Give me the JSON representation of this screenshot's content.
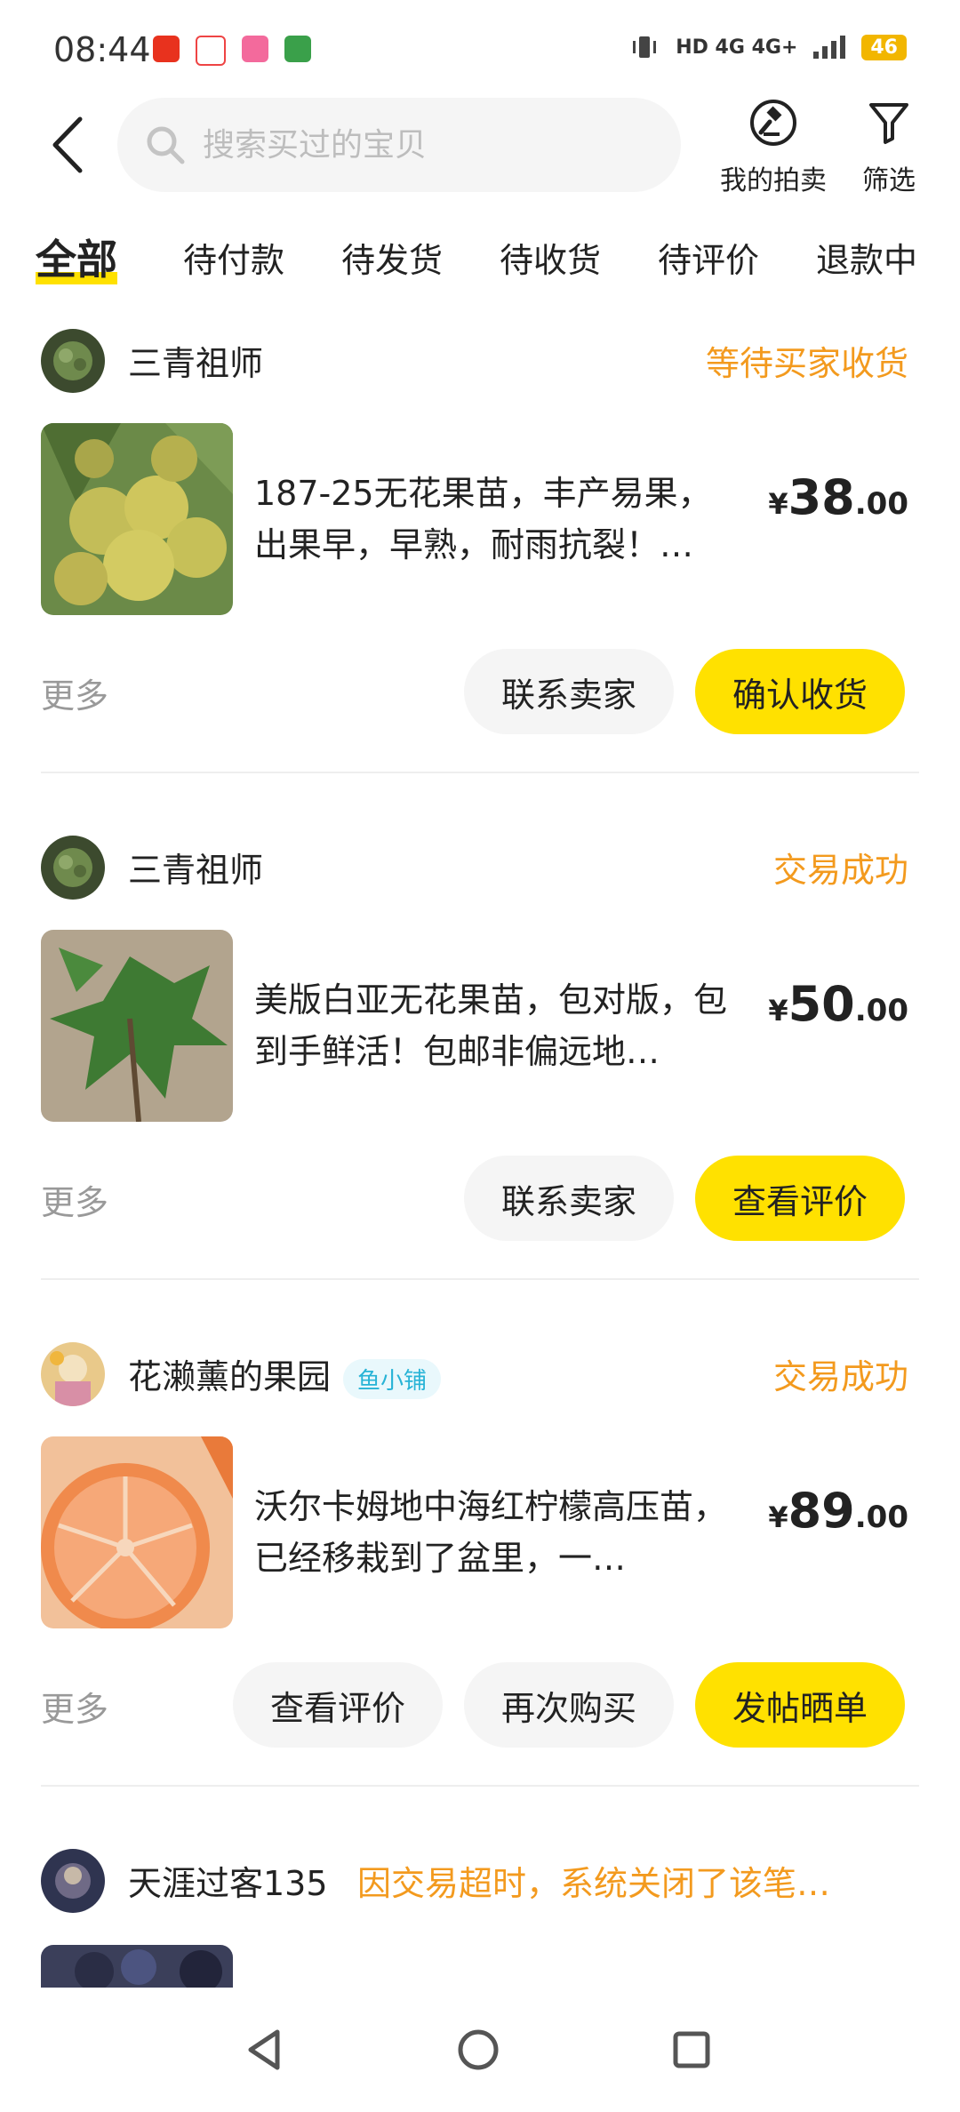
{
  "status_bar": {
    "time": "08:44",
    "network": "HD 4G 4G+",
    "battery": "46"
  },
  "search": {
    "placeholder": "搜索买过的宝贝"
  },
  "header": {
    "auction_label": "我的拍卖",
    "filter_label": "筛选"
  },
  "tabs": [
    {
      "label": "全部",
      "active": true
    },
    {
      "label": "待付款"
    },
    {
      "label": "待发货"
    },
    {
      "label": "待收货"
    },
    {
      "label": "待评价"
    },
    {
      "label": "退款中"
    }
  ],
  "orders": [
    {
      "shop": "三青祖师",
      "status": "等待买家收货",
      "title": "187-25无花果苗，丰产易果，出果早，早熟，耐雨抗裂！…",
      "price_currency": "¥",
      "price_int": "38",
      "price_dec": ".00",
      "more": "更多",
      "buttons": [
        "联系卖家",
        "确认收货"
      ]
    },
    {
      "shop": "三青祖师",
      "status": "交易成功",
      "title": "美版白亚无花果苗，包对版，包到手鲜活！包邮非偏远地…",
      "price_currency": "¥",
      "price_int": "50",
      "price_dec": ".00",
      "more": "更多",
      "buttons": [
        "联系卖家",
        "查看评价"
      ]
    },
    {
      "shop": "花濑薰的果园",
      "badge": "鱼小铺",
      "status": "交易成功",
      "title": "沃尔卡姆地中海红柠檬高压苗，已经移栽到了盆里，一…",
      "price_currency": "¥",
      "price_int": "89",
      "price_dec": ".00",
      "more": "更多",
      "buttons": [
        "查看评价",
        "再次购买",
        "发帖晒单"
      ]
    },
    {
      "shop": "天涯过客135",
      "status": "因交易超时，系统关闭了该笔…"
    }
  ],
  "colors": {
    "accent_yellow": "#ffe100",
    "status_orange": "#f39a1e",
    "badge_blue": "#27b3d6"
  }
}
